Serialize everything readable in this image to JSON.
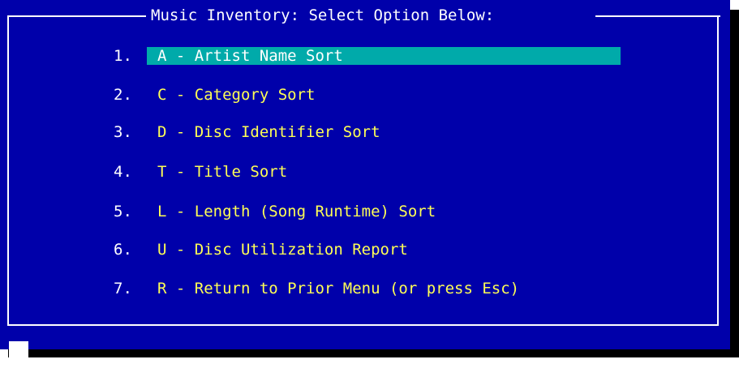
{
  "menu": {
    "title": "Music Inventory: Select Option Below:",
    "options": [
      {
        "number": "1.",
        "label": "A - Artist Name Sort"
      },
      {
        "number": "2.",
        "label": "C - Category Sort"
      },
      {
        "number": "3.",
        "label": "D - Disc Identifier Sort"
      },
      {
        "number": "4.",
        "label": "T - Title Sort"
      },
      {
        "number": "5.",
        "label": "L - Length (Song Runtime) Sort"
      },
      {
        "number": "6.",
        "label": "U - Disc Utilization Report"
      },
      {
        "number": "7.",
        "label": "R - Return to Prior Menu (or press Esc)"
      }
    ],
    "selected_index": 0
  },
  "colors": {
    "background": "#0000aa",
    "border": "#ffffff",
    "title_text": "#ffffff",
    "number_text": "#ffffff",
    "option_text": "#ffff55",
    "highlight": "#00aaaa",
    "shadow": "#000000"
  }
}
